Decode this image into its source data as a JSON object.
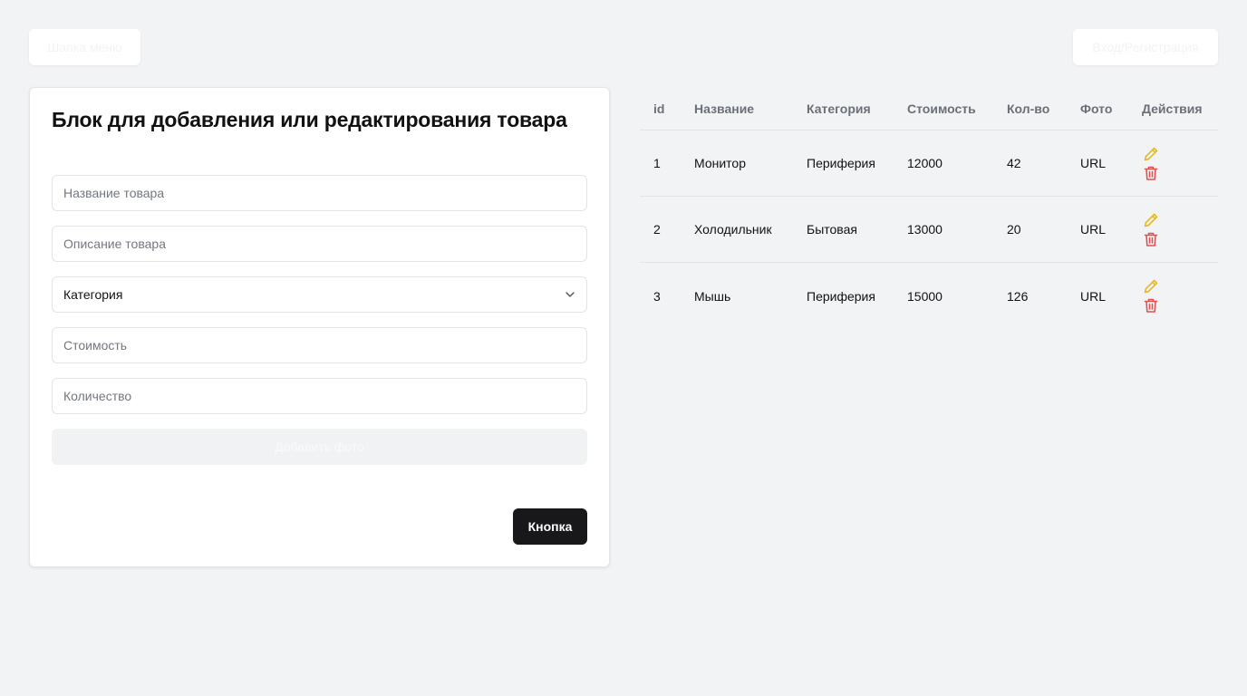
{
  "header": {
    "menu_label": "Шапка меню",
    "auth_label": "Вход/Регистрация"
  },
  "form": {
    "title": "Блок для добавления или редактирования товара",
    "name_placeholder": "Название товара",
    "description_placeholder": "Описание товара",
    "category_selected": "Категория",
    "price_placeholder": "Стоимость",
    "quantity_placeholder": "Количество",
    "photo_button": "Добавить фото",
    "submit_button": "Кнопка"
  },
  "table": {
    "columns": [
      "id",
      "Название",
      "Категория",
      "Стоимость",
      "Кол-во",
      "Фото",
      "Действия"
    ],
    "rows": [
      {
        "id": "1",
        "name": "Монитор",
        "category": "Периферия",
        "price": "12000",
        "qty": "42",
        "photo": "URL"
      },
      {
        "id": "2",
        "name": "Холодильник",
        "category": "Бытовая",
        "price": "13000",
        "qty": "20",
        "photo": "URL"
      },
      {
        "id": "3",
        "name": "Мышь",
        "category": "Периферия",
        "price": "15000",
        "qty": "126",
        "photo": "URL"
      }
    ],
    "edit_icon": "pencil-icon",
    "delete_icon": "trash-icon"
  },
  "colors": {
    "background": "#f2f3f5",
    "primary_button": "#18181b",
    "edit_icon": "#e5b91e",
    "delete_icon": "#e05252"
  }
}
